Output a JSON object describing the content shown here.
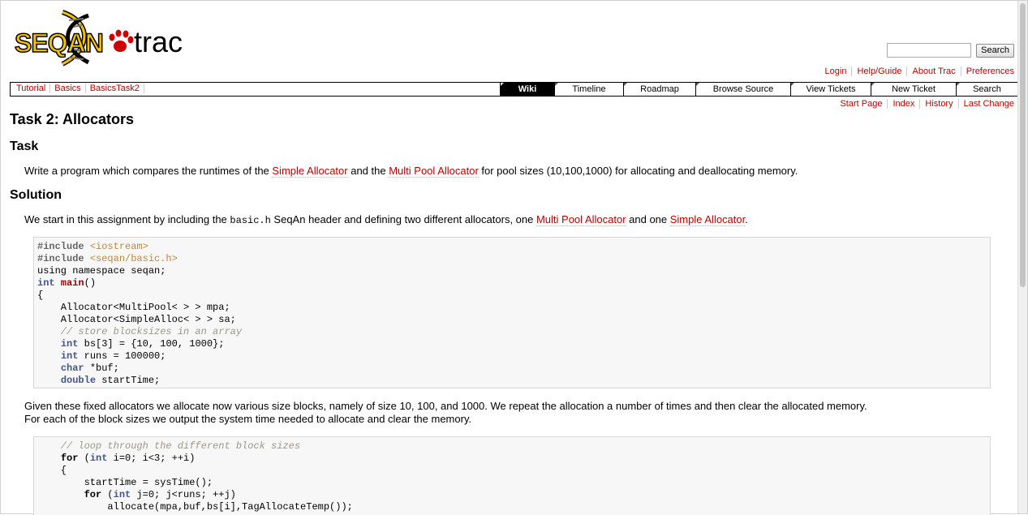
{
  "header": {
    "logo_text_left": "SEQAN",
    "logo_text_right": "trac",
    "search_placeholder": "",
    "search_button": "Search"
  },
  "metanav": [
    "Login",
    "Help/Guide",
    "About Trac",
    "Preferences"
  ],
  "breadcrumbs": [
    "Tutorial",
    "Basics",
    "BasicsTask2"
  ],
  "mainnav": [
    {
      "label": "Wiki",
      "active": true,
      "width": 66
    },
    {
      "label": "Timeline",
      "active": false,
      "width": 84
    },
    {
      "label": "Roadmap",
      "active": false,
      "width": 88
    },
    {
      "label": "Browse Source",
      "active": false,
      "width": 116
    },
    {
      "label": "View Tickets",
      "active": false,
      "width": 98
    },
    {
      "label": "New Ticket",
      "active": false,
      "width": 104
    },
    {
      "label": "Search",
      "active": false,
      "width": 75
    }
  ],
  "ctxtnav": [
    "Start Page",
    "Index",
    "History",
    "Last Change"
  ],
  "page": {
    "title": "Task 2: Allocators",
    "section1_heading": "Task",
    "task_text_1": "Write a program which compares the runtimes of the ",
    "task_link_1": "Simple Allocator",
    "task_text_2": " and the ",
    "task_link_2": "Multi Pool Allocator",
    "task_text_3": " for pool sizes (10,100,1000) for allocating and deallocating memory.",
    "section2_heading": "Solution",
    "sol_text_1": "We start in this assignment by including the ",
    "sol_code": "basic.h",
    "sol_text_2": " SeqAn header and defining two different allocators, one ",
    "sol_link_1": "Multi Pool Allocator",
    "sol_text_3": " and one ",
    "sol_link_2": "Simple Allocator",
    "sol_text_4": ".",
    "para3_line1": "Given these fixed allocators we allocate now various size blocks, namely of size 10, 100, and 1000. We repeat the allocation a number of times and then clear the allocated memory.",
    "para3_line2": "For each of the block sizes we output the system time needed to allocate and clear the memory."
  },
  "code1": [
    [
      [
        "pp",
        "#include "
      ],
      [
        "str",
        "<iostream>"
      ]
    ],
    [
      [
        "pp",
        "#include "
      ],
      [
        "str",
        "<seqan/basic.h>"
      ]
    ],
    [
      [
        "",
        "using namespace seqan;"
      ]
    ],
    [
      [
        "ty",
        "int"
      ],
      [
        "",
        ""
      ],
      [
        "fn",
        " main"
      ],
      [
        "",
        "()"
      ]
    ],
    [
      [
        "",
        "{"
      ]
    ],
    [
      [
        "",
        "    Allocator<MultiPool< > > mpa;"
      ]
    ],
    [
      [
        "",
        "    Allocator<SimpleAlloc< > > sa;"
      ]
    ],
    [
      [
        "cm",
        "    // store blocksizes in an array"
      ]
    ],
    [
      [
        "",
        "    "
      ],
      [
        "ty",
        "int"
      ],
      [
        "",
        " bs[3] = {10, 100, 1000};"
      ]
    ],
    [
      [
        "",
        "    "
      ],
      [
        "ty",
        "int"
      ],
      [
        "",
        " runs = 100000;"
      ]
    ],
    [
      [
        "",
        "    "
      ],
      [
        "ty",
        "char"
      ],
      [
        "",
        " *buf;"
      ]
    ],
    [
      [
        "",
        "    "
      ],
      [
        "ty",
        "double"
      ],
      [
        "",
        " startTime;"
      ]
    ]
  ],
  "code2": [
    [
      [
        "cm",
        "    // loop through the different block sizes"
      ]
    ],
    [
      [
        "",
        "    "
      ],
      [
        "kw",
        "for"
      ],
      [
        "",
        " ("
      ],
      [
        "ty",
        "int"
      ],
      [
        "",
        " i=0; i<3; ++i)"
      ]
    ],
    [
      [
        "",
        "    {"
      ]
    ],
    [
      [
        "",
        "        startTime = sysTime();"
      ]
    ],
    [
      [
        "",
        "        "
      ],
      [
        "kw",
        "for"
      ],
      [
        "",
        " ("
      ],
      [
        "ty",
        "int"
      ],
      [
        "",
        " j=0; j<runs; ++j)"
      ]
    ],
    [
      [
        "",
        "            allocate(mpa,buf,bs[i],TagAllocateTemp());"
      ]
    ]
  ]
}
